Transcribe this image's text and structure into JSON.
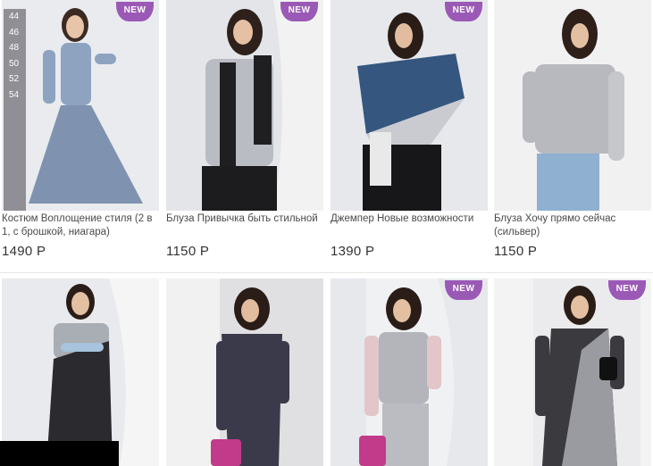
{
  "colors": {
    "badge": "#9b59b6",
    "sizes_bar": "#8f8f95"
  },
  "badge_label": "NEW",
  "sizes": [
    "44",
    "46",
    "48",
    "50",
    "52",
    "54"
  ],
  "row1": [
    {
      "name": "Костюм Воплощение стиля (2 в 1, с брошкой, ниагара)",
      "price": "1490 Р",
      "badge": true
    },
    {
      "name": "Блуза Привычка быть стильной",
      "price": "1150 Р",
      "badge": true
    },
    {
      "name": "Джемпер Новые возможности",
      "price": "1390 Р",
      "badge": true
    },
    {
      "name": "Блуза Хочу прямо сейчас (сильвер)",
      "price": "1150 Р",
      "badge": false
    }
  ],
  "row2": [
    {
      "badge": false
    },
    {
      "badge": false
    },
    {
      "badge": true
    },
    {
      "badge": true
    }
  ]
}
